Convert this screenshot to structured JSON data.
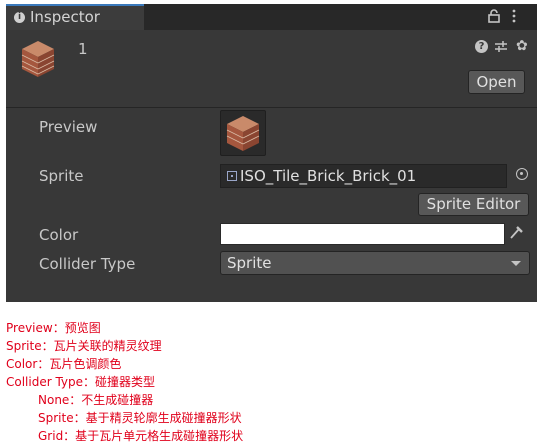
{
  "window": {
    "tab_label": "Inspector"
  },
  "header": {
    "asset_name": "1",
    "open_button": "Open"
  },
  "fields": {
    "preview_label": "Preview",
    "sprite_label": "Sprite",
    "sprite_value": "ISO_Tile_Brick_Brick_01",
    "sprite_editor_button": "Sprite Editor",
    "color_label": "Color",
    "color_value": "#ffffff",
    "collider_type_label": "Collider Type",
    "collider_type_value": "Sprite"
  },
  "notes": [
    "Preview：预览图",
    "Sprite：瓦片关联的精灵纹理",
    "Color：瓦片色调颜色",
    "Collider Type：碰撞器类型",
    "None：不生成碰撞器",
    "Sprite：基于精灵轮廓生成碰撞器形状",
    "Grid：基于瓦片单元格生成碰撞器形状"
  ],
  "colors": {
    "panel": "#383838",
    "tab_accent": "#3a79bb",
    "note_text": "#e0001b"
  },
  "icons": [
    "info-icon",
    "lock-icon",
    "kebab-menu-icon",
    "help-icon",
    "preset-icon",
    "settings-icon",
    "object-picker-icon",
    "eyedropper-icon",
    "dropdown-arrow-icon",
    "brick-tile-icon"
  ]
}
